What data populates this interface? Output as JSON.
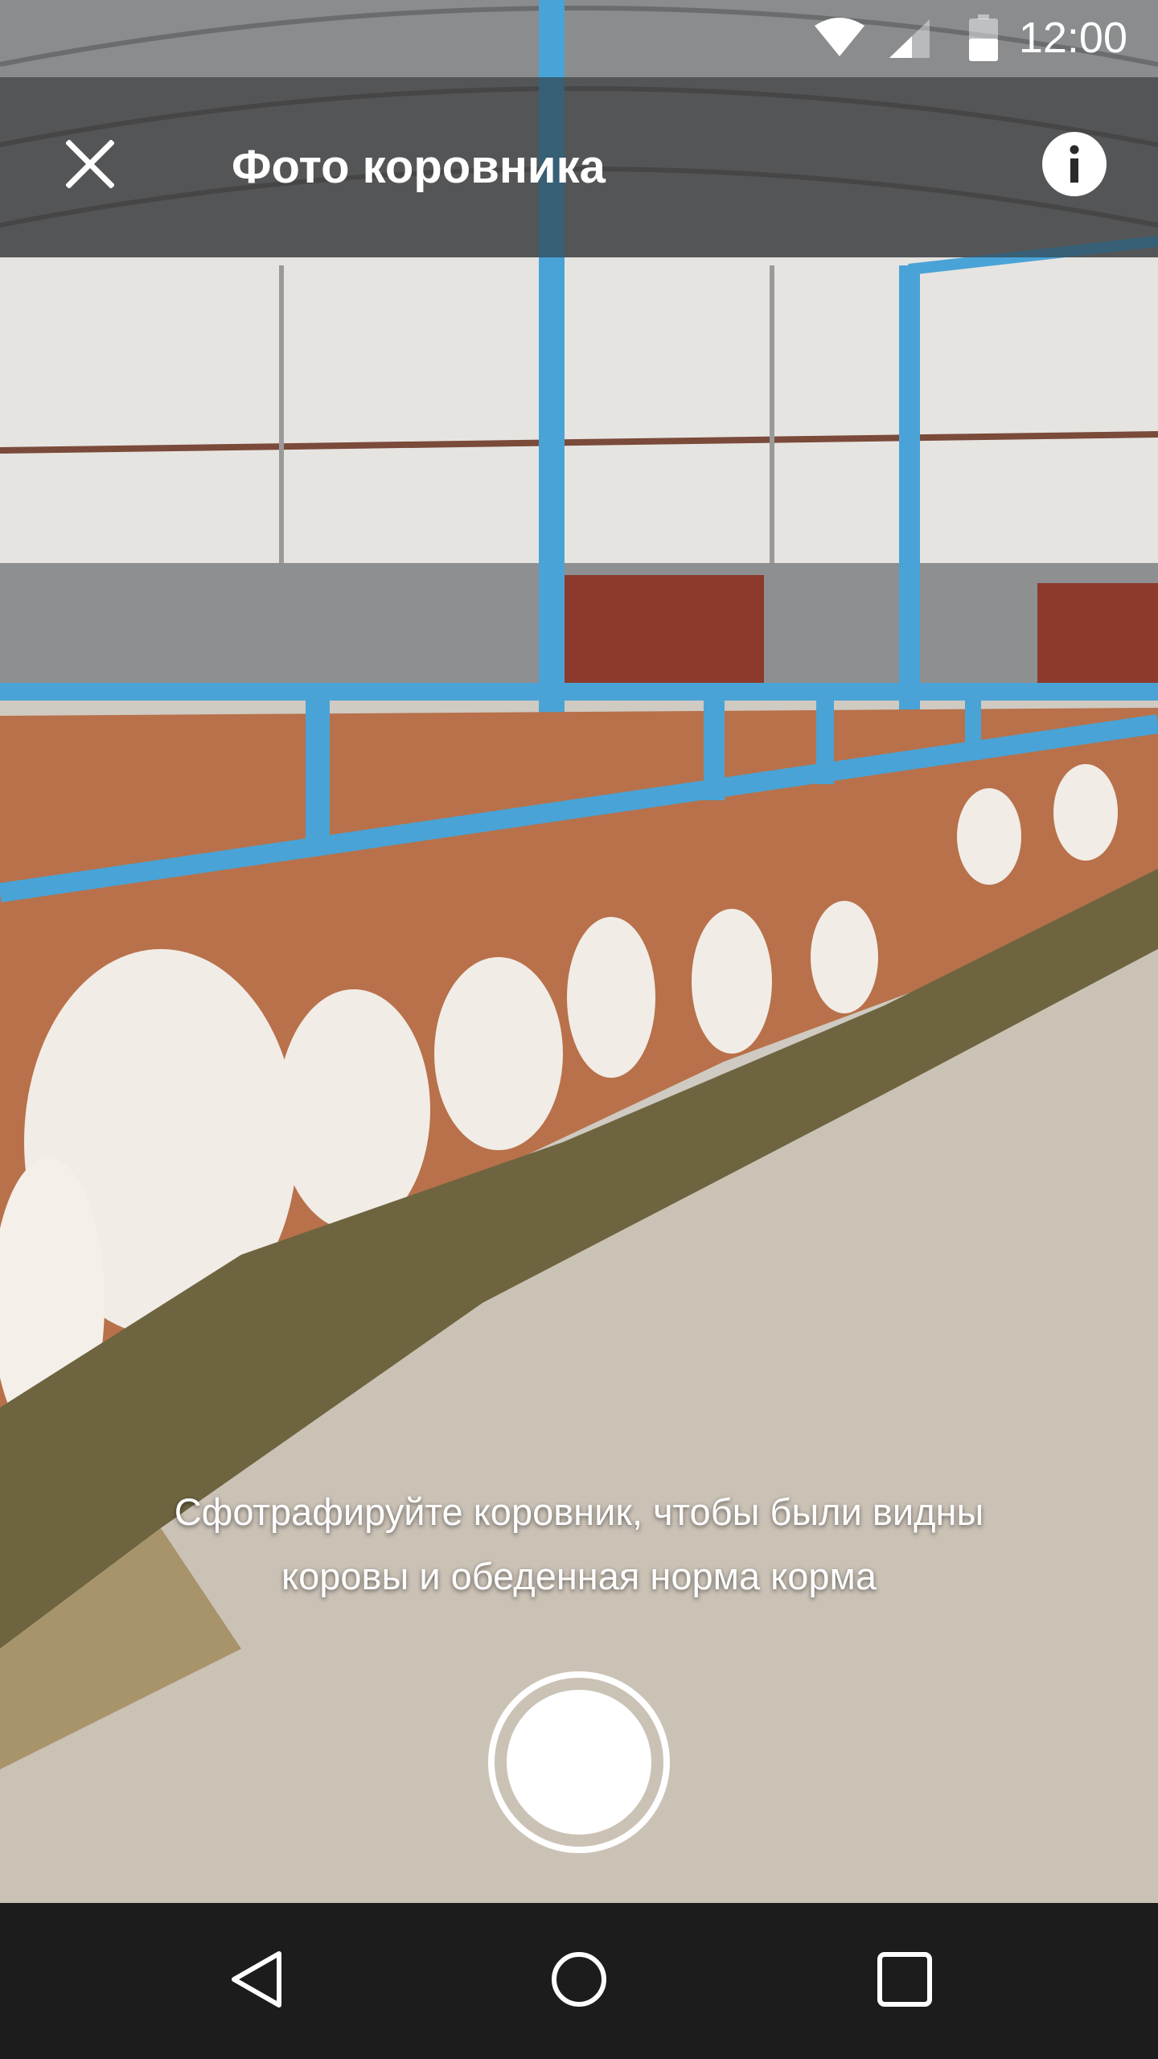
{
  "status_bar": {
    "time": "12:00",
    "icons": [
      "wifi-icon",
      "cell-signal-icon",
      "battery-icon"
    ]
  },
  "app_bar": {
    "title": "Фото коровника",
    "close_icon": "close-icon",
    "info_icon": "info-icon"
  },
  "camera": {
    "hint_line1": "Сфотрафируйте коровник, чтобы были видны",
    "hint_line2": "коровы и обеденная норма корма",
    "shutter_icon": "shutter-icon"
  },
  "nav_bar": {
    "icons": [
      "back-icon",
      "home-icon",
      "recents-icon"
    ],
    "background": "#1c1c1c"
  }
}
